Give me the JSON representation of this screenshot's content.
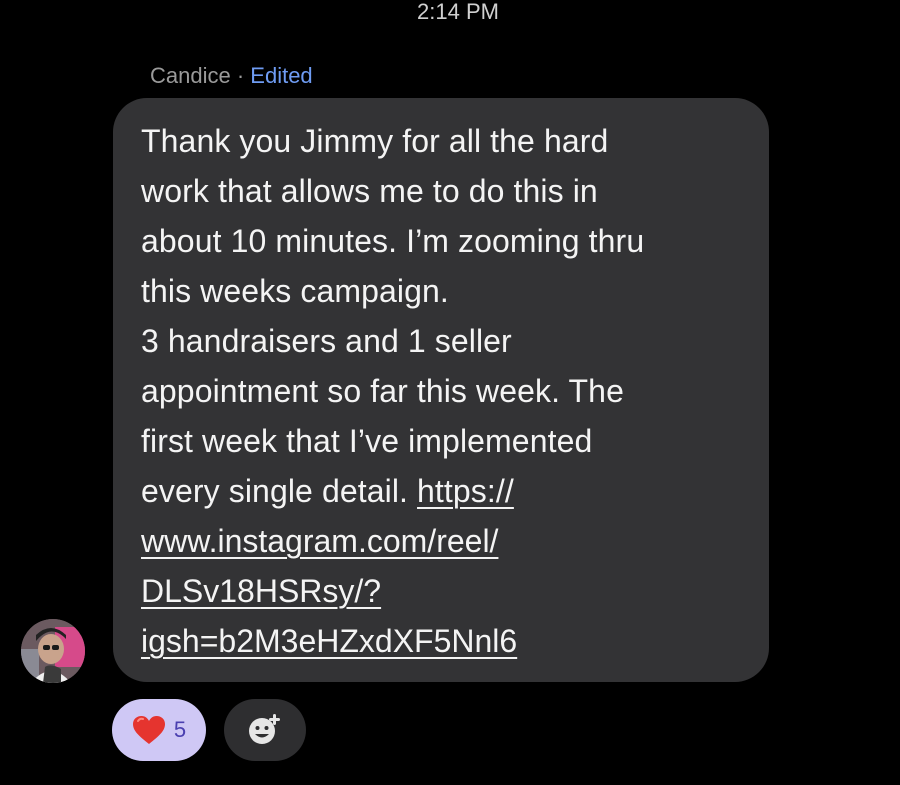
{
  "header": {
    "timestamp": "2:14 PM"
  },
  "message": {
    "sender": "Candice",
    "separator": " · ",
    "edited_label": "Edited",
    "body": "Thank you Jimmy for all the hard\nwork that allows me to do this in\nabout 10 minutes.  I’m zooming thru\nthis weeks  campaign.\n3 handraisers and 1 seller\nappointment so far this week.  The\nfirst week that I’ve implemented\nevery single detail.  ",
    "link_first_line": "https://",
    "link_rest": "www.instagram.com/reel/\nDLSv18HSRsy/?\nigsh=b2M3eHZxdXF5Nnl6",
    "bubble_color": "#333335",
    "edited_color": "#6f9cf3"
  },
  "reactions": {
    "heart_icon": "heart-icon",
    "heart_count": "5",
    "pill_color": "#cfc8f5",
    "add_icon": "add-reaction-icon"
  }
}
